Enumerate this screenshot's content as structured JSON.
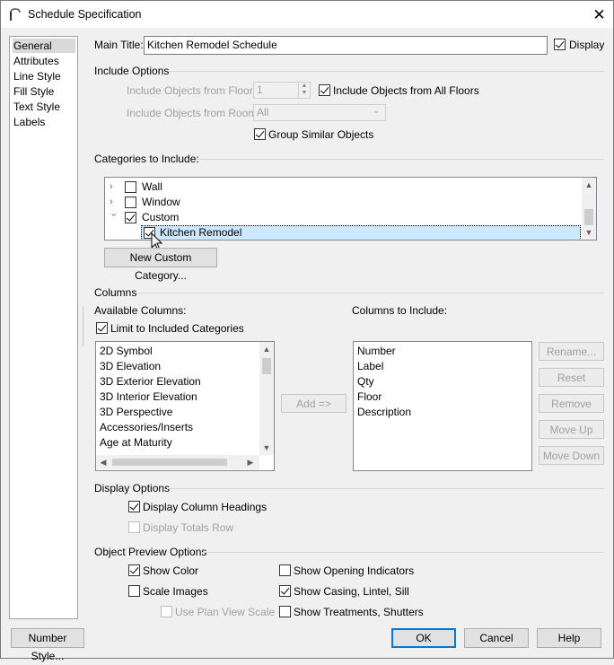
{
  "window": {
    "title": "Schedule Specification",
    "close_glyph": "✕",
    "app_icon": "arch-icon"
  },
  "sidebar": {
    "items": [
      {
        "label": "General"
      },
      {
        "label": "Attributes"
      },
      {
        "label": "Line Style"
      },
      {
        "label": "Fill Style"
      },
      {
        "label": "Text Style"
      },
      {
        "label": "Labels"
      }
    ]
  },
  "main_title": {
    "label": "Main Title:",
    "value": "Kitchen Remodel Schedule",
    "display_label": "Display"
  },
  "include_options": {
    "header": "Include Options",
    "floor_label": "Include Objects from Floor:",
    "floor_value": "1",
    "all_floors_label": "Include Objects from All Floors",
    "room_label": "Include Objects from Room:",
    "room_value": "All",
    "group_similar_label": "Group Similar Objects"
  },
  "categories": {
    "header": "Categories to Include:",
    "tree": [
      {
        "label": "Wall"
      },
      {
        "label": "Window"
      },
      {
        "label": "Custom"
      },
      {
        "label": "Kitchen Remodel"
      }
    ],
    "new_button": "New Custom Category..."
  },
  "columns": {
    "header": "Columns",
    "available_label": "Available Columns:",
    "limit_label": "Limit to Included Categories",
    "available": [
      "2D Symbol",
      "3D Elevation",
      "3D Exterior Elevation",
      "3D Interior Elevation",
      "3D Perspective",
      "Accessories/Inserts",
      "Age at Maturity"
    ],
    "include_label": "Columns to Include:",
    "included": [
      "Number",
      "Label",
      "Qty",
      "Floor",
      "Description"
    ],
    "add_button": "Add =>",
    "rename_button": "Rename...",
    "reset_button": "Reset",
    "remove_button": "Remove",
    "move_up_button": "Move Up",
    "move_down_button": "Move Down"
  },
  "display_options": {
    "header": "Display Options",
    "column_headings": "Display Column Headings",
    "totals_row": "Display Totals Row"
  },
  "preview_options": {
    "header": "Object Preview Options",
    "show_color": "Show Color",
    "scale_images": "Scale Images",
    "use_plan_view_scale": "Use Plan View Scale",
    "show_opening": "Show Opening Indicators",
    "show_casing": "Show Casing, Lintel, Sill",
    "show_treatments": "Show Treatments, Shutters"
  },
  "footer": {
    "number_style": "Number Style...",
    "ok": "OK",
    "cancel": "Cancel",
    "help": "Help"
  },
  "colors": {
    "selection": "#cce8ff",
    "default_border": "#0078d7"
  }
}
